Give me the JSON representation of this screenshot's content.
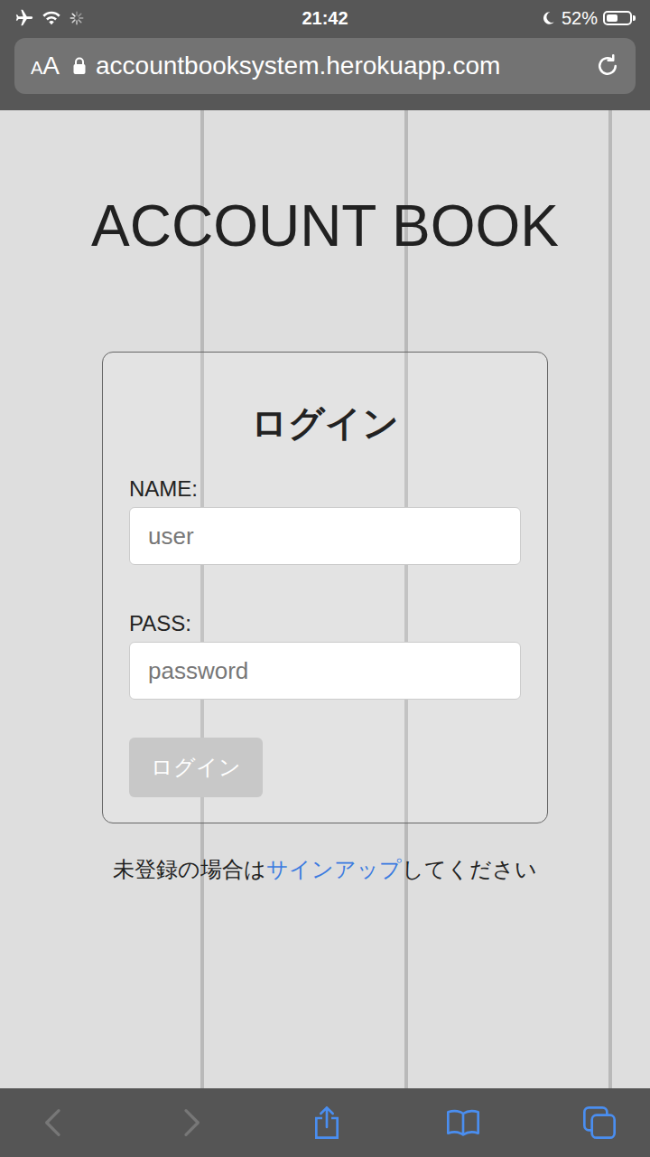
{
  "status_bar": {
    "time": "21:42",
    "battery": "52%",
    "battery_level": 0.52,
    "airplane_mode": true,
    "wifi": true,
    "loading": true,
    "do_not_disturb": true
  },
  "browser": {
    "text_size_glyphs": [
      "A",
      "A"
    ],
    "url": "accountbooksystem.herokuapp.com",
    "secure": true,
    "back_enabled": false,
    "forward_enabled": false
  },
  "page": {
    "title": "ACCOUNT BOOK",
    "login": {
      "heading": "ログイン",
      "fields": [
        {
          "label": "NAME:",
          "placeholder": "user"
        },
        {
          "label": "PASS:",
          "placeholder": "password"
        }
      ],
      "submit": {
        "label": "ログイン",
        "disabled": true
      }
    },
    "signup": {
      "before": "未登録の場合は",
      "link": "サインアップ",
      "after": "してください"
    }
  }
}
